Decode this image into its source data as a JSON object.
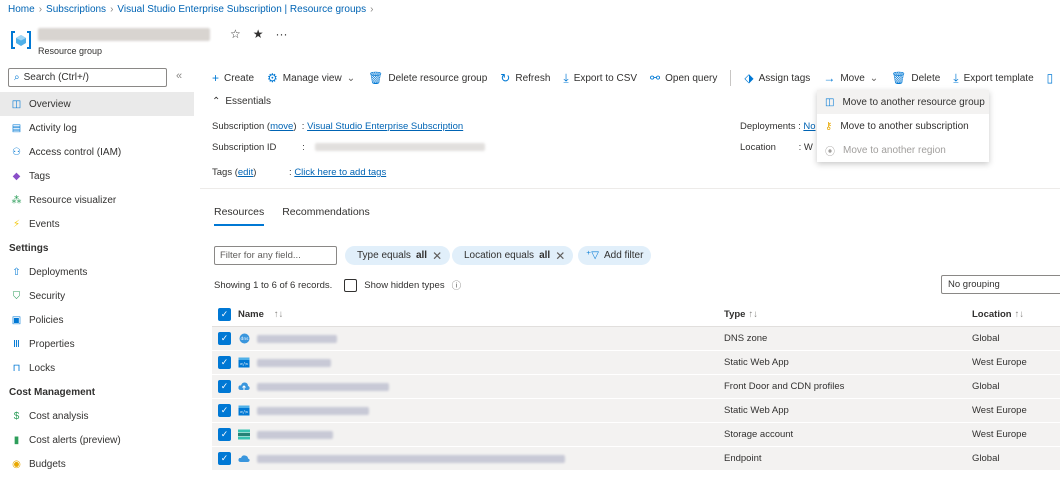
{
  "breadcrumb": [
    {
      "label": "Home"
    },
    {
      "label": "Subscriptions"
    },
    {
      "label": "Visual Studio Enterprise Subscription | Resource groups"
    }
  ],
  "header": {
    "subtitle": "Resource group",
    "pin_icon": "pin-icon",
    "star_icon": "star-icon",
    "more": "···"
  },
  "sidebar": {
    "search_placeholder": "Search (Ctrl+/)",
    "collapse": "«",
    "items": [
      {
        "label": "Overview",
        "icon": "resource-group-icon"
      },
      {
        "label": "Activity log",
        "icon": "activity-log-icon"
      },
      {
        "label": "Access control (IAM)",
        "icon": "iam-icon"
      },
      {
        "label": "Tags",
        "icon": "tag-icon"
      },
      {
        "label": "Resource visualizer",
        "icon": "visualizer-icon"
      },
      {
        "label": "Events",
        "icon": "lightning-icon"
      }
    ],
    "settings_heading": "Settings",
    "settings_items": [
      {
        "label": "Deployments",
        "icon": "deployments-icon"
      },
      {
        "label": "Security",
        "icon": "shield-icon"
      },
      {
        "label": "Policies",
        "icon": "policies-icon"
      },
      {
        "label": "Properties",
        "icon": "properties-icon"
      },
      {
        "label": "Locks",
        "icon": "lock-icon"
      }
    ],
    "cost_heading": "Cost Management",
    "cost_items": [
      {
        "label": "Cost analysis",
        "icon": "cost-analysis-icon"
      },
      {
        "label": "Cost alerts (preview)",
        "icon": "cost-alerts-icon"
      },
      {
        "label": "Budgets",
        "icon": "budgets-icon"
      }
    ]
  },
  "toolbar": {
    "create": "Create",
    "manage_view": "Manage view",
    "delete_rg": "Delete resource group",
    "refresh": "Refresh",
    "export_csv": "Export to CSV",
    "open_query": "Open query",
    "assign_tags": "Assign tags",
    "move": "Move",
    "delete": "Delete",
    "export_template": "Export template"
  },
  "move_menu": [
    {
      "label": "Move to another resource group",
      "enabled": true
    },
    {
      "label": "Move to another subscription",
      "enabled": true
    },
    {
      "label": "Move to another region",
      "enabled": false
    }
  ],
  "essentials": {
    "heading": "Essentials",
    "subscription_label": "Subscription",
    "subscription_move": "move",
    "subscription_value": "Visual Studio Enterprise Subscription",
    "subscription_id_label": "Subscription ID",
    "tags_label": "Tags",
    "tags_edit": "edit",
    "tags_value": "Click here to add tags",
    "deployments_label": "Deployments",
    "deployments_value": "No",
    "location_label": "Location",
    "location_value": "W"
  },
  "tabs": [
    "Resources",
    "Recommendations"
  ],
  "filters": {
    "placeholder": "Filter for any field...",
    "type_prefix": "Type equals",
    "type_value": "all",
    "location_prefix": "Location equals",
    "location_value": "all",
    "add_filter": "Add filter"
  },
  "records": {
    "summary": "Showing 1 to 6 of 6 records.",
    "show_hidden": "Show hidden types",
    "grouping": "No grouping"
  },
  "table": {
    "columns": [
      "Name",
      "Type",
      "Location"
    ],
    "rows": [
      {
        "type": "DNS zone",
        "location": "Global",
        "icon": "dns-zone-icon",
        "name_width": 80
      },
      {
        "type": "Static Web App",
        "location": "West Europe",
        "icon": "static-web-app-icon",
        "name_width": 74
      },
      {
        "type": "Front Door and CDN profiles",
        "location": "Global",
        "icon": "front-door-icon",
        "name_width": 132
      },
      {
        "type": "Static Web App",
        "location": "West Europe",
        "icon": "static-web-app-icon",
        "name_width": 112
      },
      {
        "type": "Storage account",
        "location": "West Europe",
        "icon": "storage-account-icon",
        "name_width": 76
      },
      {
        "type": "Endpoint",
        "location": "Global",
        "icon": "cdn-endpoint-icon",
        "name_width": 308
      }
    ]
  },
  "colors": {
    "accent": "#0078d4",
    "link": "#0064b4",
    "pill_bg": "#e1effa",
    "row_bg": "#f3f2f1"
  }
}
